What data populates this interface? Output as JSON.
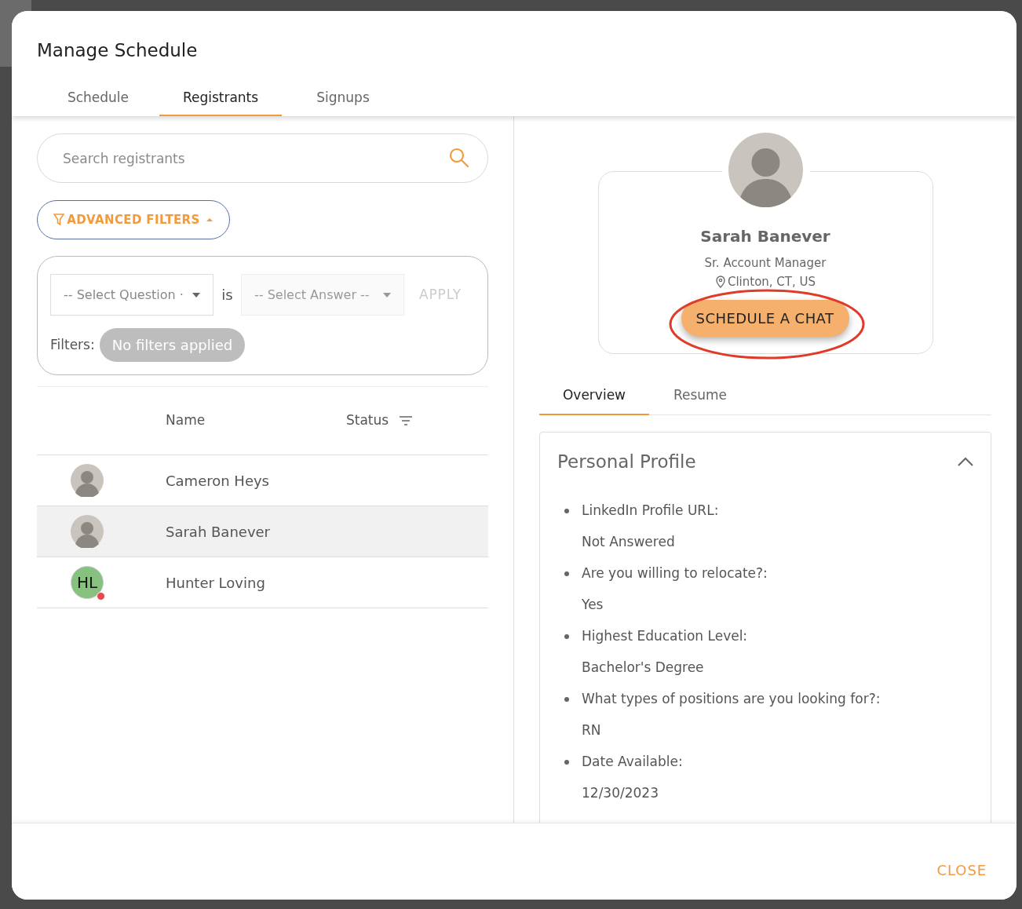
{
  "dialog": {
    "title": "Manage Schedule"
  },
  "tabs": [
    {
      "label": "Schedule",
      "selected": false
    },
    {
      "label": "Registrants",
      "selected": true
    },
    {
      "label": "Signups",
      "selected": false
    }
  ],
  "search": {
    "placeholder": "Search registrants"
  },
  "advanced_filters": {
    "label": "ADVANCED FILTERS",
    "expanded": true
  },
  "filter": {
    "question_placeholder": "-- Select Question ·",
    "operator": "is",
    "answer_placeholder": "-- Select Answer --",
    "apply": {
      "label": "APPLY",
      "disabled": true
    },
    "filters_label": "Filters:",
    "chip": "No filters applied"
  },
  "table": {
    "columns": [
      "Name",
      "Status"
    ],
    "rows": [
      {
        "name": "Cameron Heys",
        "selected": false,
        "alert_dot": false
      },
      {
        "name": "Sarah Banever",
        "selected": true,
        "alert_dot": false
      },
      {
        "name": "Hunter Loving",
        "initials": "HL",
        "selected": false,
        "alert_dot": true
      }
    ]
  },
  "profile": {
    "name": "Sarah Banever",
    "title": "Sr. Account Manager",
    "location": "Clinton, CT, US",
    "button": "SCHEDULE A CHAT",
    "highlighted": true
  },
  "detail_tabs": [
    {
      "label": "Overview",
      "selected": true
    },
    {
      "label": "Resume",
      "selected": false
    }
  ],
  "section": {
    "title": "Personal Profile",
    "expanded": true,
    "items": [
      {
        "label": "LinkedIn Profile URL:",
        "value": "Not Answered"
      },
      {
        "label": "Are you willing to relocate?:",
        "value": "Yes"
      },
      {
        "label": "Highest Education Level:",
        "value": "Bachelor's Degree"
      },
      {
        "label": "What types of positions are you looking for?:",
        "value": "RN"
      },
      {
        "label": "Date Available:",
        "value": "12/30/2023"
      }
    ]
  },
  "footer": {
    "close": "CLOSE"
  }
}
